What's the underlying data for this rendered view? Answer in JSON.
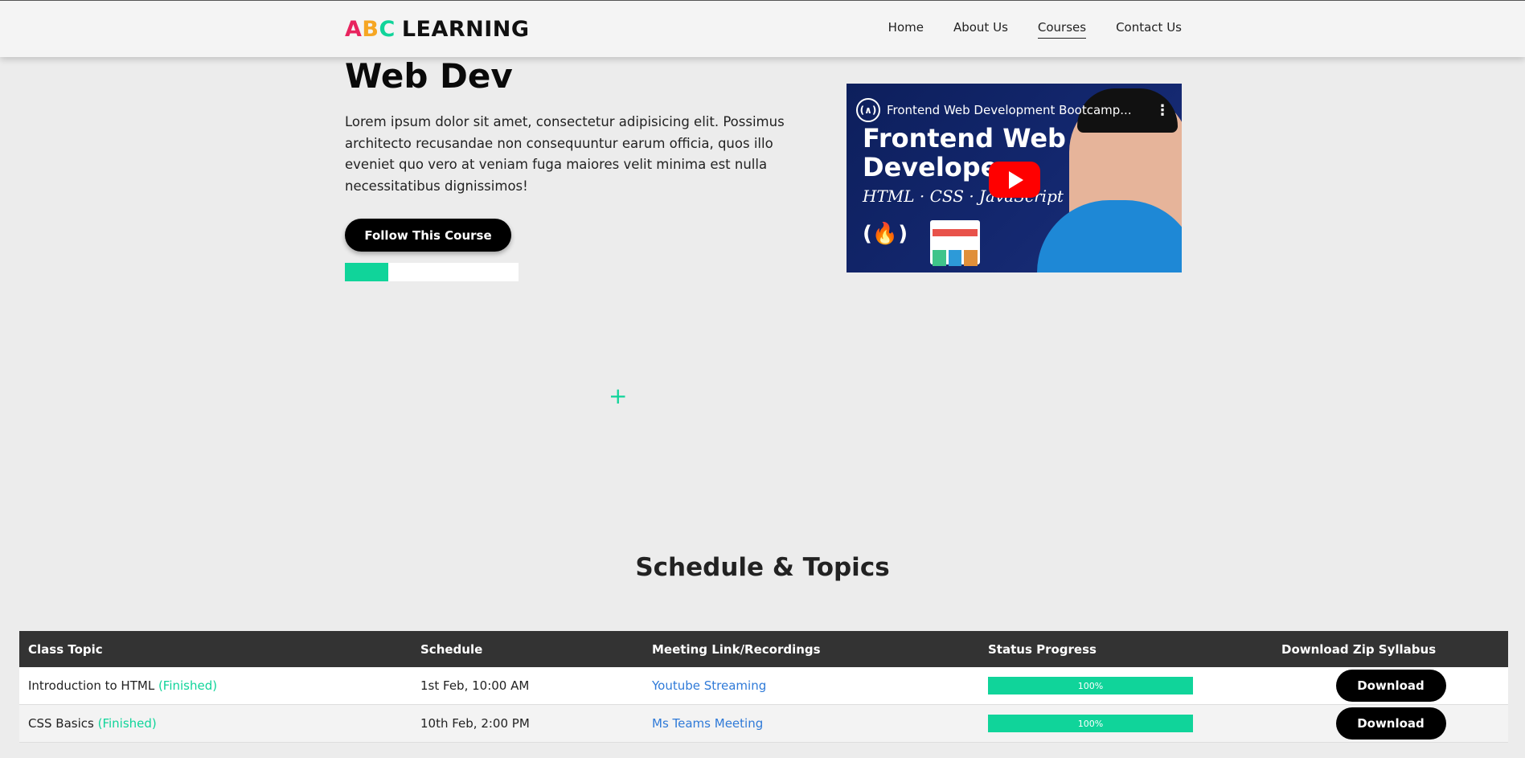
{
  "brand": {
    "a": "A",
    "b": "B",
    "c": "C",
    "rest": "LEARNING"
  },
  "nav": {
    "home": "Home",
    "about": "About Us",
    "courses": "Courses",
    "contact": "Contact Us"
  },
  "hero": {
    "title": "Web Dev",
    "description": "Lorem ipsum dolor sit amet, consectetur adipisicing elit. Possimus architecto recusandae non consequuntur earum officia, quos illo eveniet quo vero at veniam fuga maiores velit minima est nulla necessitatibus dignissimos!",
    "follow_label": "Follow This Course",
    "progress_fraction": 0.25
  },
  "video": {
    "title": "Frontend Web Development Bootcamp...",
    "big_text": "Frontend Web Developer",
    "subtitle": "HTML · CSS · JavaScript"
  },
  "plus_symbol": "+",
  "schedule": {
    "title": "Schedule & Topics",
    "headers": [
      "Class Topic",
      "Schedule",
      "Meeting Link/Recordings",
      "Status Progress",
      "Download Zip Syllabus"
    ],
    "rows": [
      {
        "topic": "Introduction to HTML",
        "status": "(Finished)",
        "schedule": "1st Feb, 10:00 AM",
        "link": "Youtube Streaming",
        "progress": "100%",
        "progress_value": 1.0,
        "download": "Download"
      },
      {
        "topic": "CSS Basics",
        "status": "(Finished)",
        "schedule": "10th Feb, 2:00 PM",
        "link": "Ms Teams Meeting",
        "progress": "100%",
        "progress_value": 1.0,
        "download": "Download"
      }
    ]
  },
  "colors": {
    "accent": "#10d49a",
    "logo_a": "#e8245e",
    "logo_b": "#f6a623",
    "link": "#2f7ad8"
  }
}
